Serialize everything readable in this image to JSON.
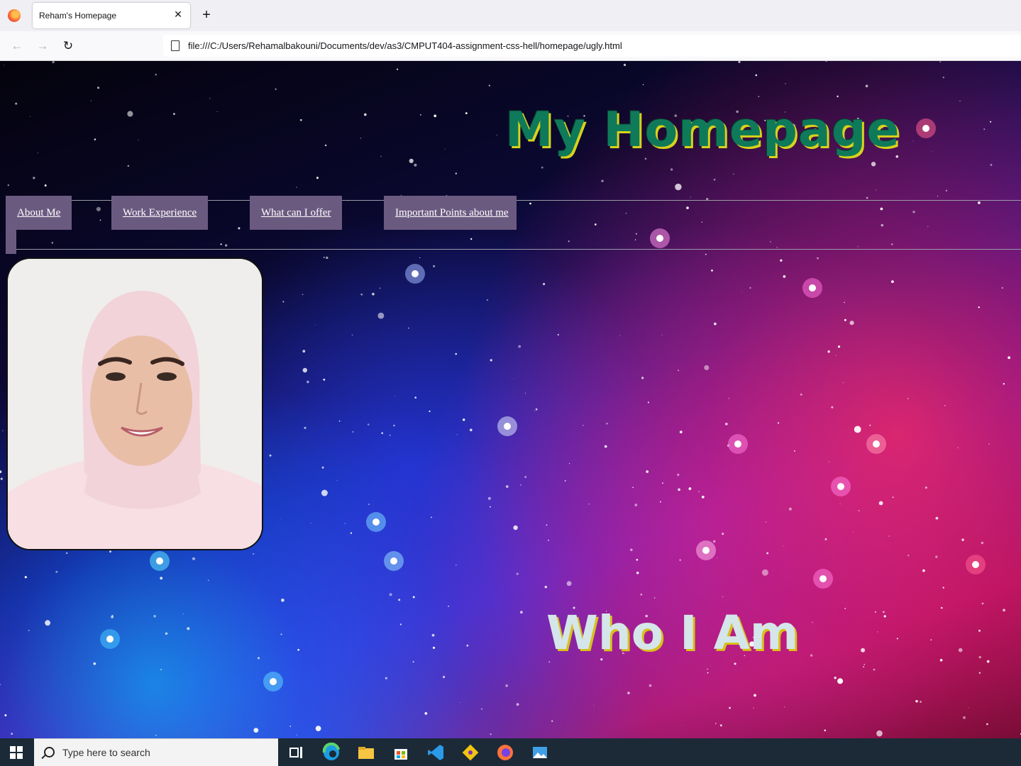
{
  "browser": {
    "tab_title": "Reham's Homepage",
    "url": "file:///C:/Users/Rehamalbakouni/Documents/dev/as3/CMPUT404-assignment-css-hell/homepage/ugly.html"
  },
  "page": {
    "title": "My Homepage",
    "nav": [
      "About Me",
      "Work Experience",
      "What can I offer",
      "Important Points about me"
    ],
    "section_heading": "Who I Am"
  },
  "taskbar": {
    "search_placeholder": "Type here to search",
    "apps": [
      "task-view-icon",
      "edge-icon",
      "file-explorer-icon",
      "store-icon",
      "vscode-icon",
      "git-icon",
      "firefox-icon",
      "photos-icon"
    ]
  },
  "colors": {
    "title_fill": "#0f7a5a",
    "title_shadow": "#d8d21a",
    "nav_bg": "#6b5a80",
    "heading_fill": "#d4e6ea"
  }
}
